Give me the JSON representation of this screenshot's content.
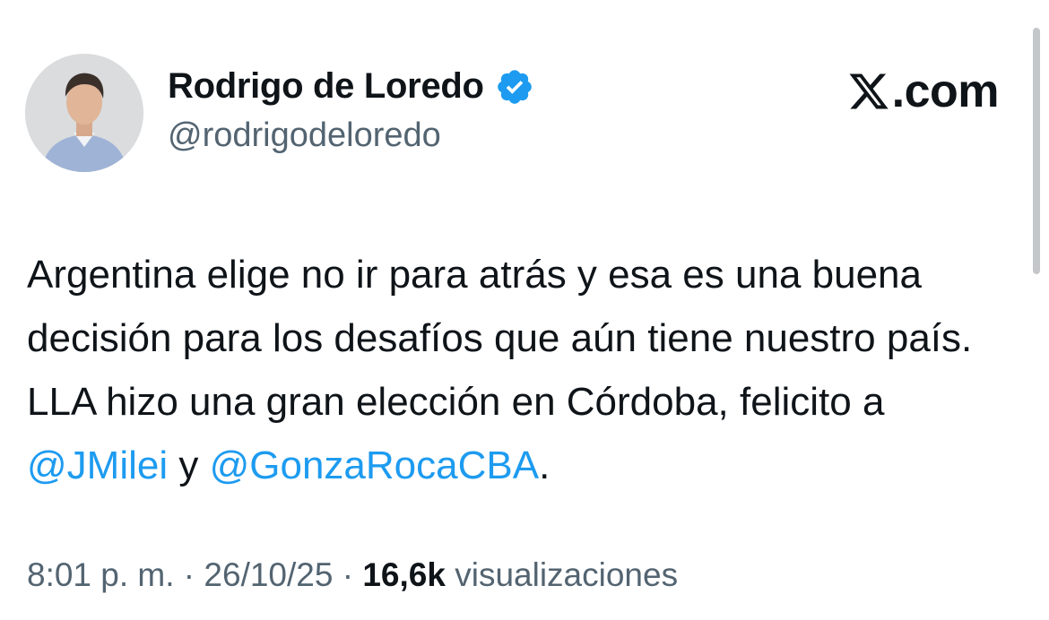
{
  "author": {
    "name": "Rodrigo de Loredo",
    "handle": "@rodrigodeloredo",
    "verified_icon": "verified-badge-icon",
    "verified_color": "#1d9bf0"
  },
  "brand": {
    "icon": "x-logo-icon",
    "text": ".com"
  },
  "tweet": {
    "text_part1": "Argentina elige no ir para atrás y esa es una buena decisión para los desafíos que aún tiene nuestro país. LLA hizo una gran elección en Córdoba, felicito a ",
    "mention1": "@JMilei",
    "text_part2": " y ",
    "mention2": "@GonzaRocaCBA",
    "text_part3": ".",
    "mention_color": "#1d9bf0"
  },
  "meta": {
    "time": "8:01 p. m.",
    "separator": " · ",
    "date": "26/10/25",
    "views_count": "16,6k",
    "views_label": " visualizaciones"
  }
}
